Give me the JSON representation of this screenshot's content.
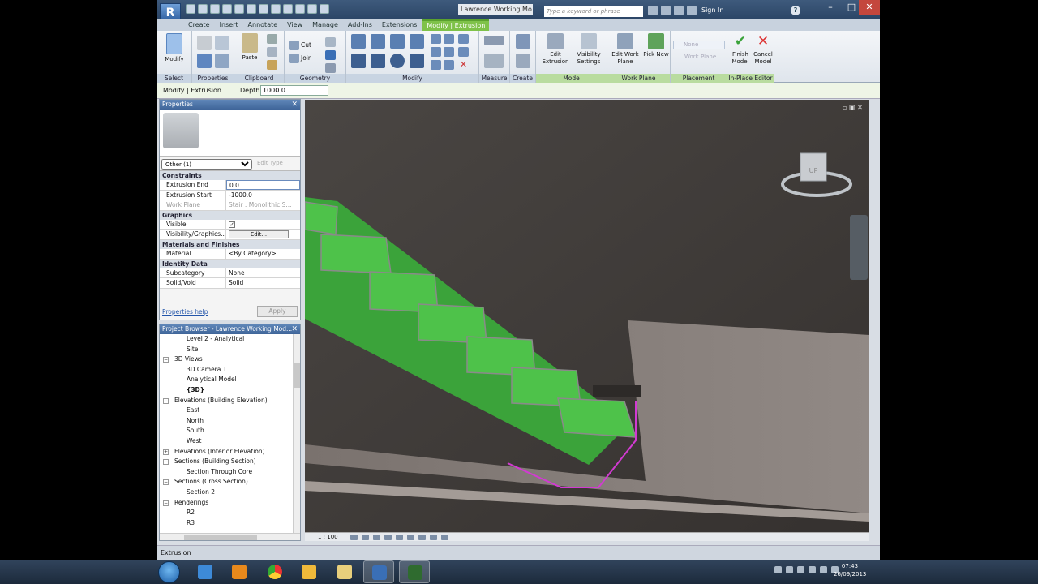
{
  "app": {
    "title_doc": "Lawrence Working Mo...",
    "search_placeholder": "Type a keyword or phrase",
    "sign_in": "Sign In",
    "help": "?"
  },
  "tabs": [
    "Create",
    "Insert",
    "Annotate",
    "View",
    "Manage",
    "Add-Ins",
    "Extensions",
    "Modify | Extrusion"
  ],
  "ribbon": {
    "groups": [
      "Select",
      "Properties",
      "Clipboard",
      "Geometry",
      "Modify",
      "Measure",
      "Create",
      "Mode",
      "Work Plane",
      "Placement",
      "In-Place Editor"
    ],
    "modify_label": "Modify",
    "paste_label": "Paste",
    "cut_label": "Cut",
    "join_label": "Join",
    "edit_extrusion": "Edit Extrusion",
    "visibility_settings": "Visibility Settings",
    "edit_work_plane": "Edit Work Plane",
    "pick_new": "Pick New",
    "finish_model": "Finish Model",
    "cancel_model": "Cancel Model",
    "placement_field": "None",
    "placement_field2": "Work Plane"
  },
  "options_bar": {
    "mode": "Modify | Extrusion",
    "depth_label": "Depth",
    "depth_value": "1000.0"
  },
  "properties": {
    "title": "Properties",
    "type_selector": "Other (1)",
    "edit_type": "Edit Type",
    "sections": {
      "constraints": "Constraints",
      "graphics": "Graphics",
      "materials": "Materials and Finishes",
      "identity": "Identity Data"
    },
    "rows": {
      "extrusion_end": {
        "k": "Extrusion End",
        "v": "0.0"
      },
      "extrusion_start": {
        "k": "Extrusion Start",
        "v": "-1000.0"
      },
      "work_plane": {
        "k": "Work Plane",
        "v": "Stair : Monolithic S..."
      },
      "visible": {
        "k": "Visible",
        "v": "✓"
      },
      "vis_graphics": {
        "k": "Visibility/Graphics...",
        "v": "Edit..."
      },
      "material": {
        "k": "Material",
        "v": "<By Category>"
      },
      "subcategory": {
        "k": "Subcategory",
        "v": "None"
      },
      "solid_void": {
        "k": "Solid/Void",
        "v": "Solid"
      }
    },
    "help_link": "Properties help",
    "apply": "Apply"
  },
  "project_browser": {
    "title": "Project Browser - Lawrence Working Mod...",
    "items": [
      {
        "label": "Level 2 - Analytical",
        "indent": 3,
        "toggle": ""
      },
      {
        "label": "Site",
        "indent": 3,
        "toggle": ""
      },
      {
        "label": "3D Views",
        "indent": 2,
        "toggle": "−"
      },
      {
        "label": "3D Camera 1",
        "indent": 3,
        "toggle": ""
      },
      {
        "label": "Analytical Model",
        "indent": 3,
        "toggle": ""
      },
      {
        "label": "{3D}",
        "indent": 3,
        "toggle": "",
        "bold": true
      },
      {
        "label": "Elevations (Building Elevation)",
        "indent": 2,
        "toggle": "−"
      },
      {
        "label": "East",
        "indent": 3,
        "toggle": ""
      },
      {
        "label": "North",
        "indent": 3,
        "toggle": ""
      },
      {
        "label": "South",
        "indent": 3,
        "toggle": ""
      },
      {
        "label": "West",
        "indent": 3,
        "toggle": ""
      },
      {
        "label": "Elevations (Interior Elevation)",
        "indent": 2,
        "toggle": "+"
      },
      {
        "label": "Sections (Building Section)",
        "indent": 2,
        "toggle": "−"
      },
      {
        "label": "Section Through Core",
        "indent": 3,
        "toggle": ""
      },
      {
        "label": "Sections (Cross Section)",
        "indent": 2,
        "toggle": "−"
      },
      {
        "label": "Section 2",
        "indent": 3,
        "toggle": ""
      },
      {
        "label": "Renderings",
        "indent": 2,
        "toggle": "−"
      },
      {
        "label": "R2",
        "indent": 3,
        "toggle": ""
      },
      {
        "label": "R3",
        "indent": 3,
        "toggle": ""
      }
    ]
  },
  "viewport": {
    "scale": "1 : 100",
    "viewcube_label": "UP"
  },
  "status": {
    "text": "Extrusion"
  },
  "taskbar": {
    "time": "07:43",
    "date": "26/09/2013"
  },
  "colors": {
    "context_tab": "#7fc24a",
    "stair_green": "#4ec24a",
    "void_outline": "#d23ad2",
    "titlebar": "#2b4566"
  },
  "icons": [
    "windows-start-icon",
    "ie-icon",
    "media-player-icon",
    "chrome-icon",
    "outlook-icon",
    "explorer-icon",
    "revit-icon",
    "camtasia-icon"
  ]
}
